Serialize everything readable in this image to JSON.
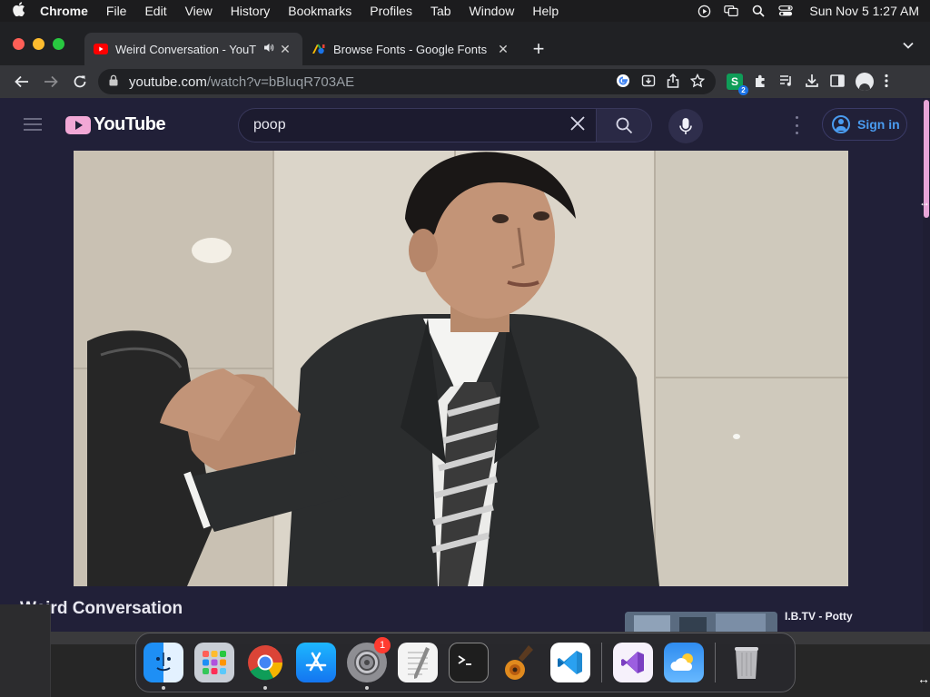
{
  "menubar": {
    "app": "Chrome",
    "items": [
      "File",
      "Edit",
      "View",
      "History",
      "Bookmarks",
      "Profiles",
      "Tab",
      "Window",
      "Help"
    ],
    "clock": "Sun Nov 5  1:27 AM"
  },
  "tabs": [
    {
      "title": "Weird Conversation - YouT",
      "favicon": "youtube-icon",
      "audio": true
    },
    {
      "title": "Browse Fonts - Google Fonts",
      "favicon": "google-fonts-icon",
      "audio": false
    }
  ],
  "omnibox": {
    "host": "youtube.com",
    "path": "/watch?v=bBluqR703AE"
  },
  "extensions": {
    "s_badge": "2"
  },
  "youtube": {
    "logo_text": "YouTube",
    "search_value": "poop",
    "signin_label": "Sign in",
    "video_title": "Weird Conversation",
    "recommended_title": "I.B.TV - Potty"
  },
  "dock": {
    "apps": [
      "finder-icon",
      "launchpad-icon",
      "chrome-icon",
      "app-store-icon",
      "system-settings-icon",
      "textedit-icon",
      "terminal-icon",
      "garageband-icon",
      "vscode-icon",
      "visual-studio-icon",
      "weather-icon",
      "trash-icon"
    ],
    "settings_badge": "1"
  },
  "colors": {
    "yt_bg": "#212038",
    "yt_accent": "#f2a8d6",
    "signin_blue": "#4a9cf0"
  }
}
